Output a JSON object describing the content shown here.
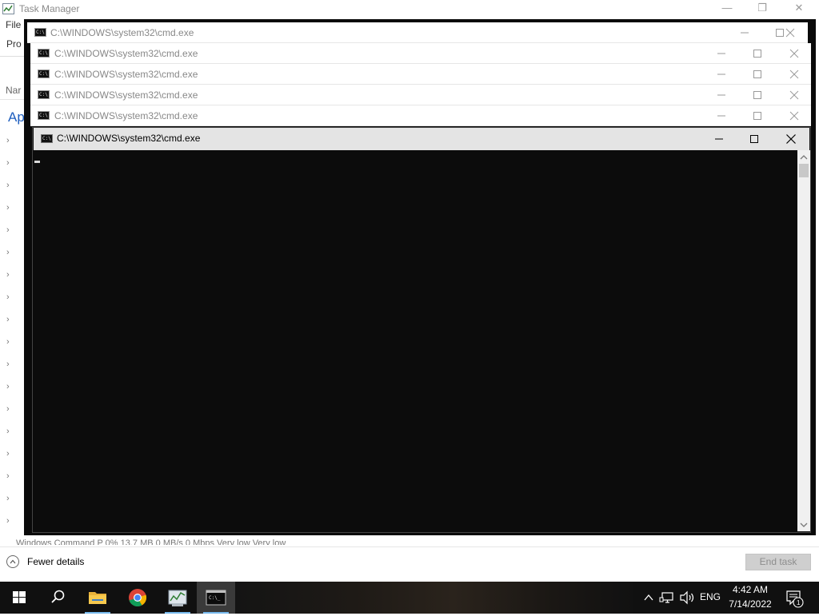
{
  "task_manager": {
    "title": "Task Manager",
    "menu_partial": "File",
    "tab_partial": "Pro",
    "column_partial": "Nar",
    "section_partial": "Ap",
    "bottom_row_partial": "Windows Command P    0%     13.7 MB    0 MB/s    0 Mbps    Very low    Very low",
    "fewer_details_label": "Fewer details",
    "end_task_label": "End task"
  },
  "cmd_windows": [
    {
      "title": "C:\\WINDOWS\\system32\\cmd.exe"
    },
    {
      "title": "C:\\WINDOWS\\system32\\cmd.exe"
    },
    {
      "title": "C:\\WINDOWS\\system32\\cmd.exe"
    },
    {
      "title": "C:\\WINDOWS\\system32\\cmd.exe"
    },
    {
      "title": "C:\\WINDOWS\\system32\\cmd.exe"
    }
  ],
  "active_cmd": {
    "title": "C:\\WINDOWS\\system32\\cmd.exe",
    "icon_text": "C:\\"
  },
  "taskbar": {
    "apps": [
      "windows-start",
      "search",
      "file-explorer",
      "chrome",
      "task-manager",
      "command-prompt"
    ],
    "active_app": "command-prompt",
    "tray": {
      "language": "ENG",
      "time": "4:42 AM",
      "date": "7/14/2022",
      "notification_count": "1"
    }
  },
  "colors": {
    "accent": "#76b9ed",
    "console_bg": "#0c0c0c",
    "section_blue": "#1f5fbf"
  }
}
